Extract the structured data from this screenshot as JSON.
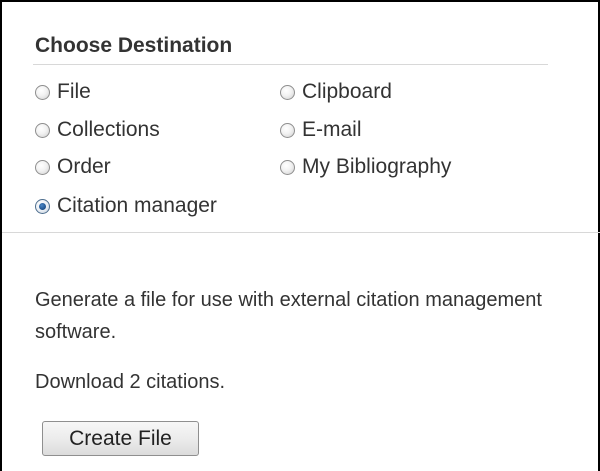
{
  "destination": {
    "heading": "Choose Destination",
    "options": [
      {
        "label": "File",
        "checked": false
      },
      {
        "label": "Clipboard",
        "checked": false
      },
      {
        "label": "Collections",
        "checked": false
      },
      {
        "label": "E-mail",
        "checked": false
      },
      {
        "label": "Order",
        "checked": false
      },
      {
        "label": "My Bibliography",
        "checked": false
      },
      {
        "label": "Citation manager",
        "checked": true
      }
    ]
  },
  "citation_manager": {
    "description": "Generate a file for use with external citation management software.",
    "download_note": "Download 2 citations.",
    "button_label": "Create File"
  }
}
